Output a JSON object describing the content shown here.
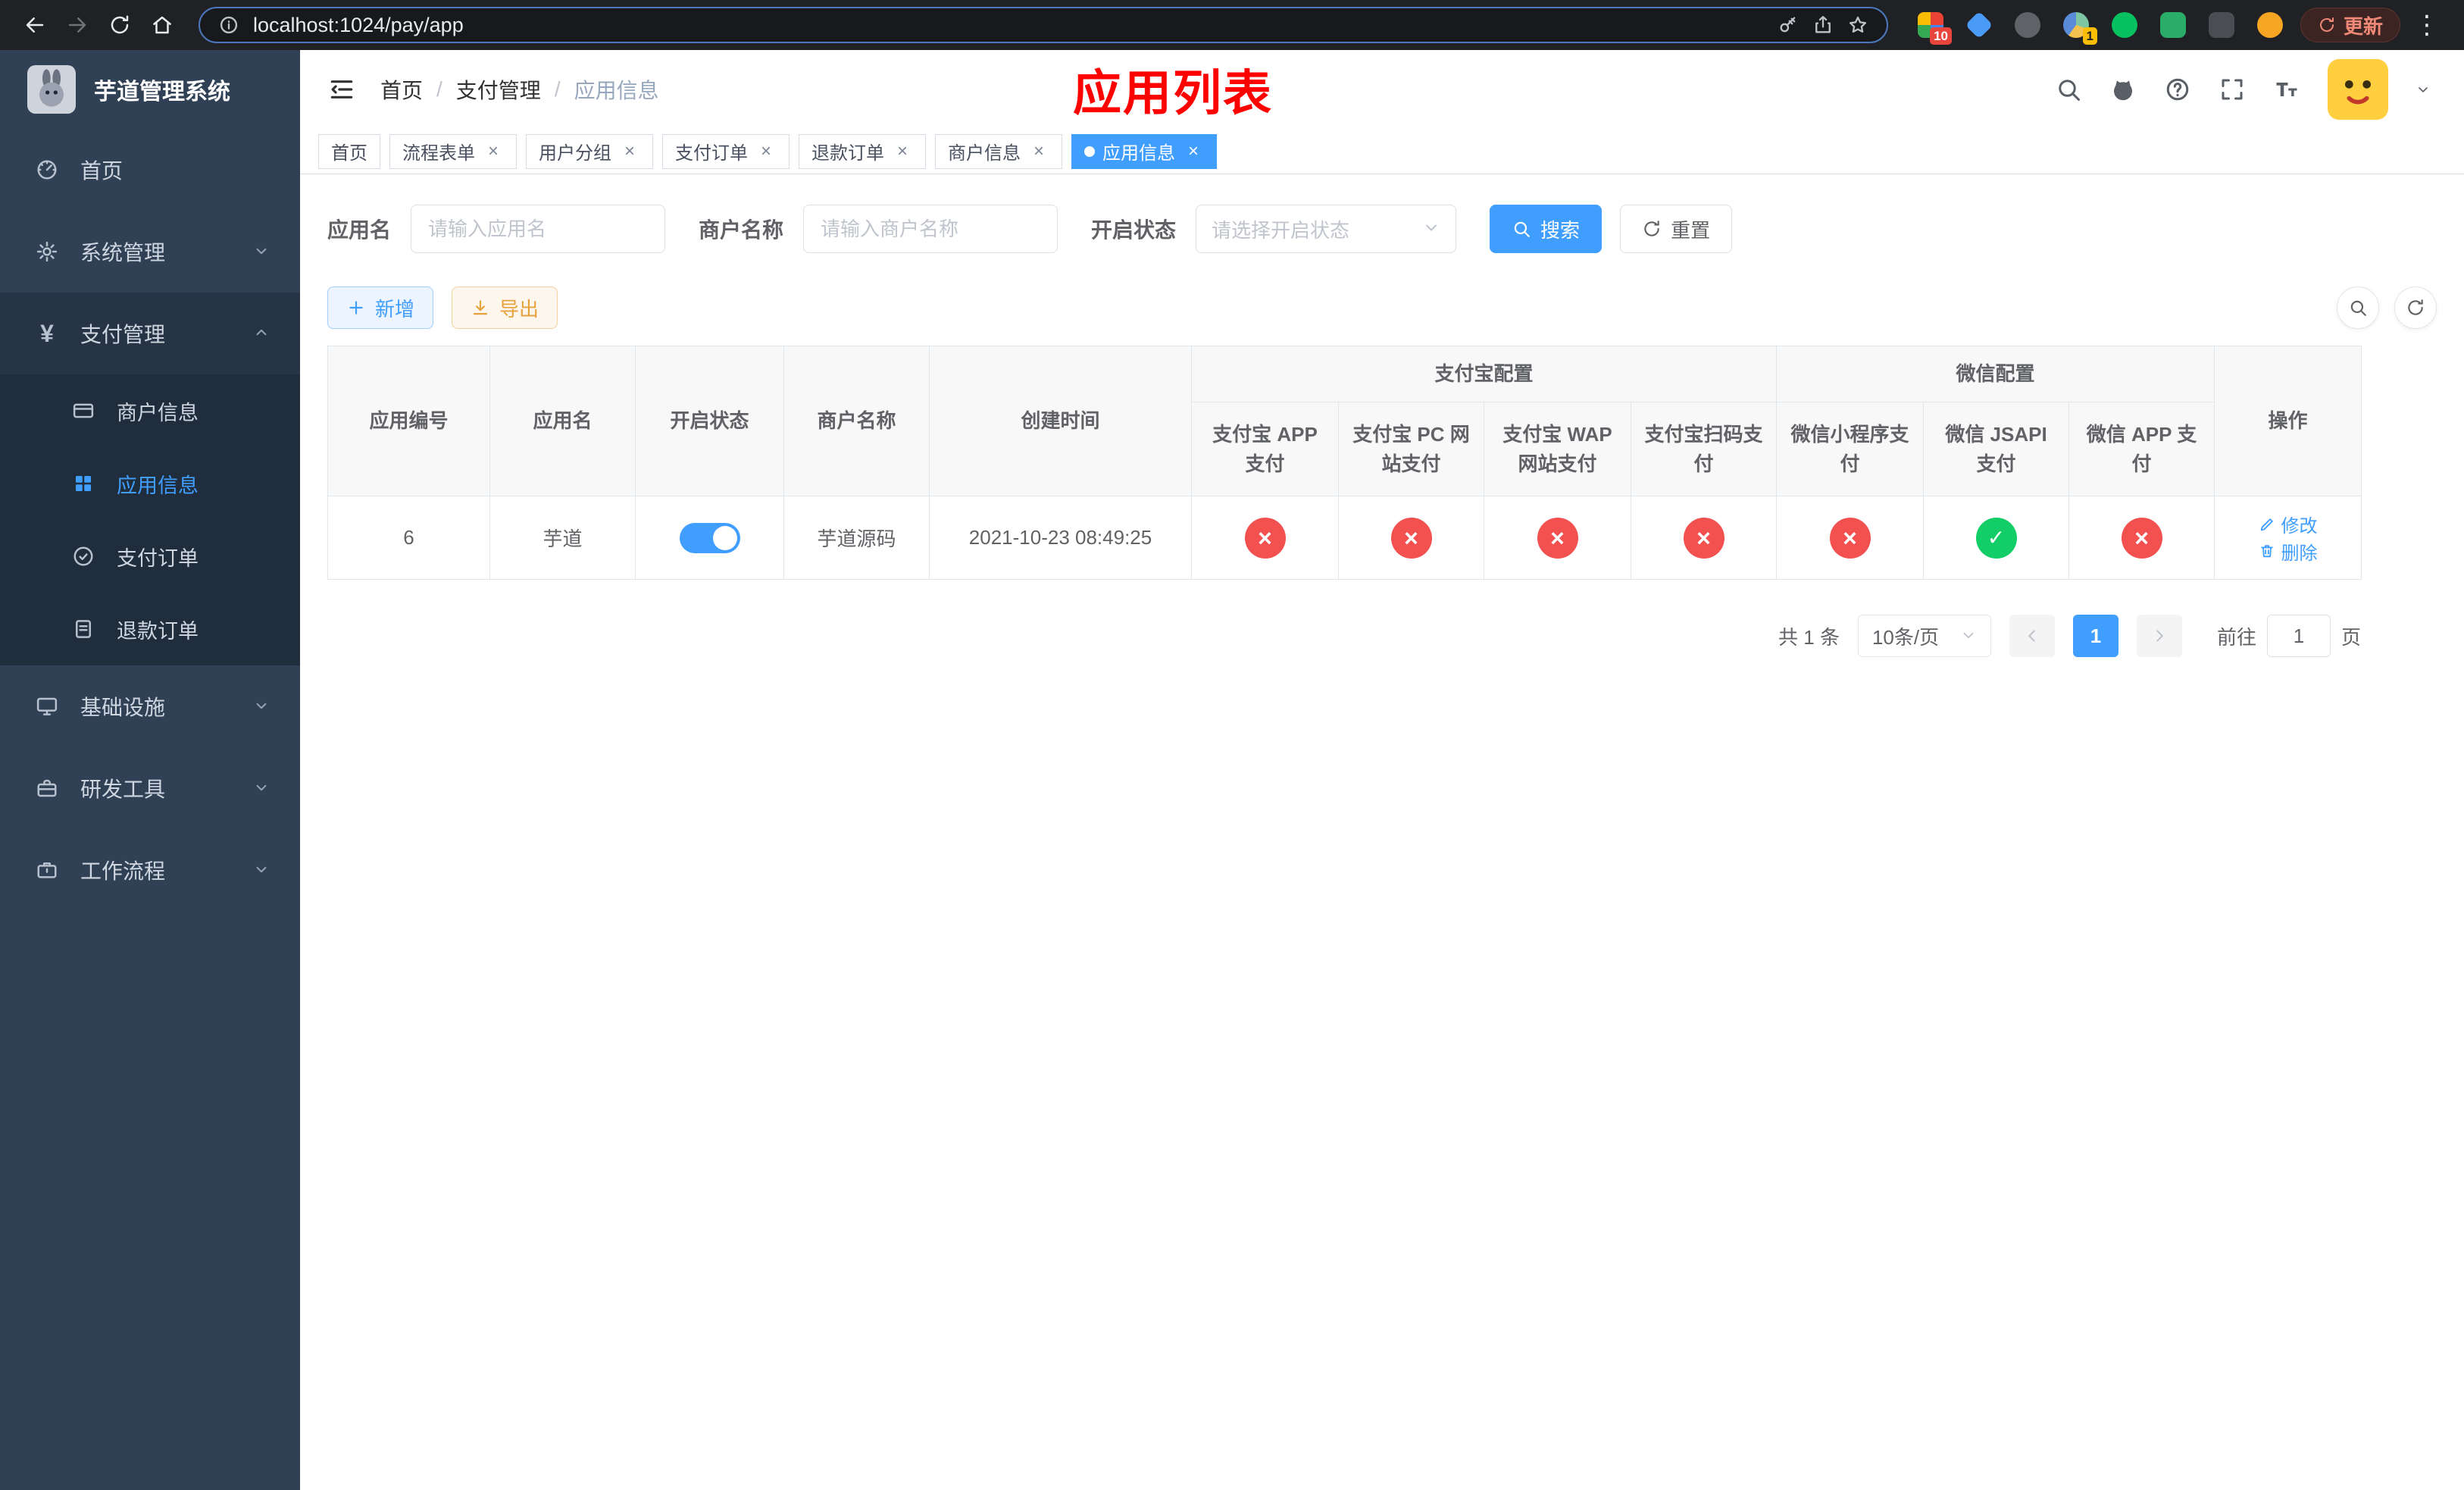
{
  "browser": {
    "url": "localhost:1024/pay/app",
    "update_label": "更新",
    "ext_badge_1": "10",
    "ext_badge_2": "1"
  },
  "sidebar": {
    "title": "芋道管理系统",
    "items": [
      {
        "label": "首页"
      },
      {
        "label": "系统管理"
      },
      {
        "label": "支付管理",
        "expanded": true,
        "children": [
          {
            "label": "商户信息"
          },
          {
            "label": "应用信息",
            "active": true
          },
          {
            "label": "支付订单"
          },
          {
            "label": "退款订单"
          }
        ]
      },
      {
        "label": "基础设施"
      },
      {
        "label": "研发工具"
      },
      {
        "label": "工作流程"
      }
    ]
  },
  "header": {
    "breadcrumb": [
      "首页",
      "支付管理",
      "应用信息"
    ],
    "page_title": "应用列表"
  },
  "tabs": [
    {
      "label": "首页",
      "closable": false
    },
    {
      "label": "流程表单",
      "closable": true
    },
    {
      "label": "用户分组",
      "closable": true
    },
    {
      "label": "支付订单",
      "closable": true
    },
    {
      "label": "退款订单",
      "closable": true
    },
    {
      "label": "商户信息",
      "closable": true
    },
    {
      "label": "应用信息",
      "closable": true,
      "active": true
    }
  ],
  "filters": {
    "app_name_label": "应用名",
    "app_name_placeholder": "请输入应用名",
    "merchant_label": "商户名称",
    "merchant_placeholder": "请输入商户名称",
    "status_label": "开启状态",
    "status_placeholder": "请选择开启状态",
    "search_button": "搜索",
    "reset_button": "重置"
  },
  "toolbar": {
    "add_button": "新增",
    "export_button": "导出"
  },
  "table": {
    "groups": {
      "alipay": "支付宝配置",
      "wechat": "微信配置"
    },
    "columns": [
      "应用编号",
      "应用名",
      "开启状态",
      "商户名称",
      "创建时间",
      "支付宝 APP 支付",
      "支付宝 PC 网站支付",
      "支付宝 WAP 网站支付",
      "支付宝扫码支付",
      "微信小程序支付",
      "微信 JSAPI 支付",
      "微信 APP 支付",
      "操作"
    ],
    "row": {
      "app_id": "6",
      "app_name": "芋道",
      "status": "on",
      "merchant_name": "芋道源码",
      "create_time": "2021-10-23 08:49:25",
      "configs": {
        "alipay_app": "closed",
        "alipay_pc": "closed",
        "alipay_wap": "closed",
        "alipay_qr": "closed",
        "wechat_mini": "closed",
        "wechat_jsapi": "open",
        "wechat_app": "closed"
      },
      "edit_label": "修改",
      "delete_label": "删除"
    }
  },
  "pagination": {
    "total": "共 1 条",
    "page_size": "10条/页",
    "page": "1",
    "goto_label": "前往",
    "goto_value": "1",
    "goto_suffix": "页"
  },
  "colors": {
    "accent_blue": "#409eff",
    "success_green": "#13ce66",
    "danger_red": "#f35050",
    "title_red": "#ff0000",
    "warning_orange": "#e6a23c",
    "sidebar_bg": "#304156"
  }
}
